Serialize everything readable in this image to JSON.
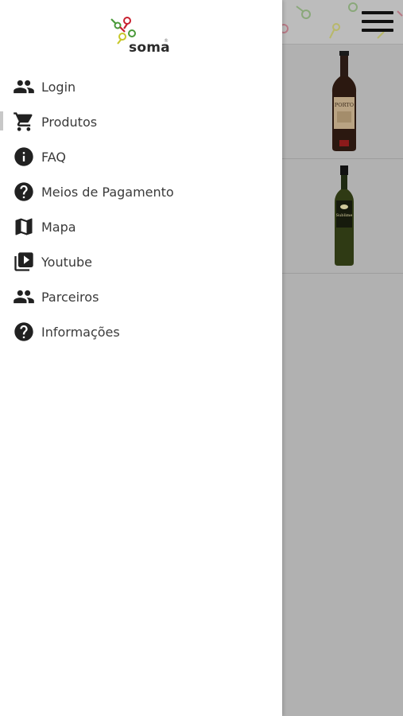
{
  "app": {
    "brand": "soma",
    "registered_mark": "®"
  },
  "menu": {
    "items": [
      {
        "id": "login",
        "label": "Login",
        "icon": "people-icon",
        "active": false
      },
      {
        "id": "produtos",
        "label": "Produtos",
        "icon": "cart-icon",
        "active": true
      },
      {
        "id": "faq",
        "label": "FAQ",
        "icon": "info-icon",
        "active": false
      },
      {
        "id": "pagamento",
        "label": "Meios de Pagamento",
        "icon": "help-icon",
        "active": false
      },
      {
        "id": "mapa",
        "label": "Mapa",
        "icon": "map-icon",
        "active": false
      },
      {
        "id": "youtube",
        "label": "Youtube",
        "icon": "video-library-icon",
        "active": false
      },
      {
        "id": "parceiros",
        "label": "Parceiros",
        "icon": "people-icon",
        "active": false
      },
      {
        "id": "informacoes",
        "label": "Informações",
        "icon": "help-icon",
        "active": false
      }
    ]
  },
  "background": {
    "products": [
      {
        "name": "porto-wine-bottle",
        "label_text": "PORTO"
      },
      {
        "name": "olive-oil-bottle",
        "label_text": "Sublime"
      }
    ]
  },
  "colors": {
    "drawer_bg": "#ffffff",
    "overlay": "#b1b1b1",
    "icon": "#212121",
    "text": "#3a3a3a",
    "logo_red": "#c8202f",
    "logo_green": "#4a9a3a",
    "logo_yellow": "#c8c82a"
  }
}
